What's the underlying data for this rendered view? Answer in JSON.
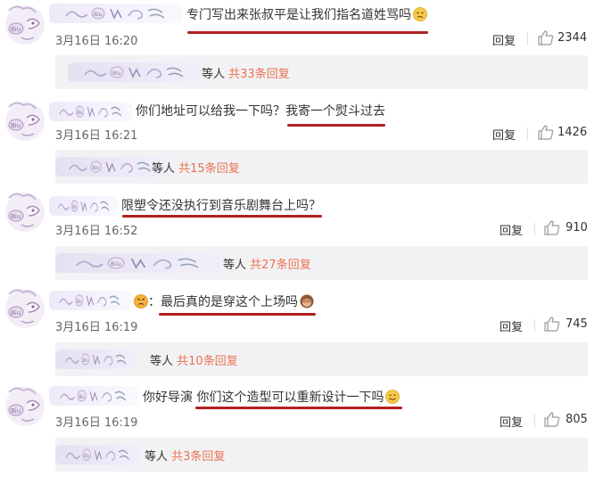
{
  "comments": [
    {
      "prefix": "",
      "text": "专门写出来张叔平是让我们指名道姓骂吗",
      "emoji": "thinking-face",
      "date": "3月16日 16:20",
      "reply_label": "回复",
      "likes": "2344",
      "sub": {
        "who": "等人",
        "count": "共33条回复"
      }
    },
    {
      "prefix": "你们地址可以给我一下吗？",
      "text": "我寄一个熨斗过去",
      "emoji": "",
      "date": "3月16日 16:21",
      "reply_label": "回复",
      "likes": "1426",
      "sub": {
        "who": "等人",
        "count": "共15条回复"
      }
    },
    {
      "prefix": "",
      "text": "限塑令还没执行到音乐剧舞台上吗？",
      "emoji": "",
      "date": "3月16日 16:52",
      "reply_label": "回复",
      "likes": "910",
      "sub": {
        "who": "等人",
        "count": "共27条回复"
      }
    },
    {
      "prefix": "：",
      "text": "最后真的是穿这个上场吗",
      "emoji": "see-no-evil-monkey",
      "date": "3月16日 16:19",
      "reply_label": "回复",
      "likes": "745",
      "sub": {
        "who": "等人",
        "count": "共10条回复"
      }
    },
    {
      "prefix": "你好导演",
      "text": "你们这个造型可以重新设计一下吗",
      "emoji": "smiling-face",
      "date": "3月16日 16:19",
      "reply_label": "回复",
      "likes": "805",
      "sub": {
        "who": "等人",
        "count": "共3条回复"
      }
    }
  ],
  "colors": {
    "underline": "#b0201f",
    "reply_count": "#eb7350",
    "sub_bg": "#f2f2f5"
  }
}
